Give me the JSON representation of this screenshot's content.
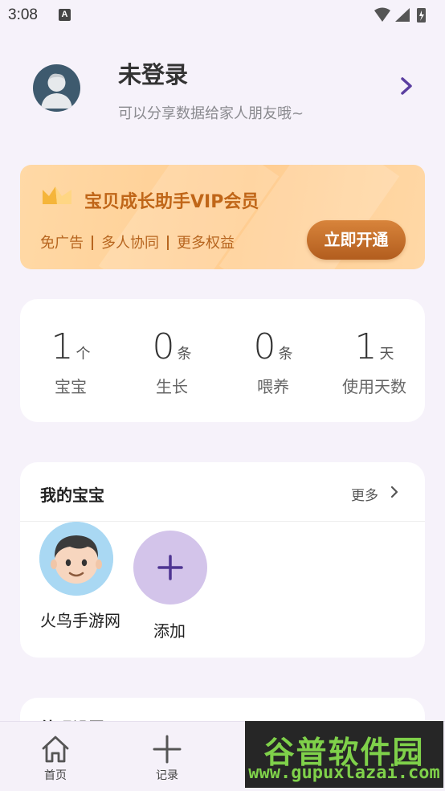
{
  "status_bar": {
    "time": "3:08",
    "notification_badge": "A",
    "icons": [
      "wifi-icon",
      "signal-icon",
      "battery-charging-icon"
    ]
  },
  "profile": {
    "name": "未登录",
    "subtitle": "可以分享数据给家人朋友哦~"
  },
  "vip": {
    "title": "宝贝成长助手VIP会员",
    "features": [
      "免广告",
      "多人协同",
      "更多权益"
    ],
    "button": "立即开通"
  },
  "stats": [
    {
      "value": "1",
      "unit": "个",
      "label": "宝宝"
    },
    {
      "value": "0",
      "unit": "条",
      "label": "生长"
    },
    {
      "value": "0",
      "unit": "条",
      "label": "喂养"
    },
    {
      "value": "1",
      "unit": "天",
      "label": "使用天数"
    }
  ],
  "babies": {
    "title": "我的宝宝",
    "more": "更多",
    "items": [
      {
        "name": "火鸟手游网"
      }
    ],
    "add_label": "添加"
  },
  "next_section": {
    "title": "外观设置"
  },
  "bottom_nav": [
    {
      "label": "首页",
      "icon": "home-icon"
    },
    {
      "label": "记录",
      "icon": "plus-icon"
    }
  ],
  "watermark": {
    "big": "谷普软件园",
    "small": "www.gupuxlazai.com"
  },
  "colors": {
    "background": "#f6f2fa",
    "vip_text": "#c06618",
    "vip_button": "#c06b28",
    "accent_purple": "#5b3fa0",
    "add_circle": "#d3c4ea"
  }
}
